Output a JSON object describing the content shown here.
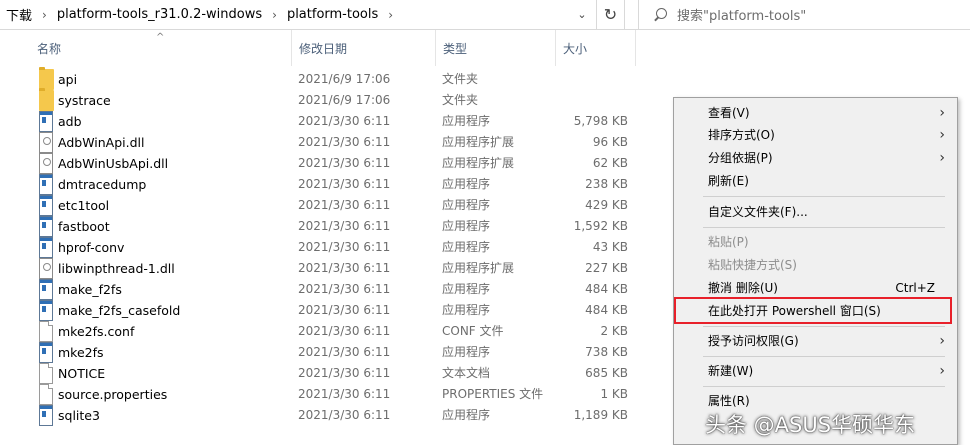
{
  "address_bar": {
    "crumbs": [
      "下载",
      "platform-tools_r31.0.2-windows",
      "platform-tools"
    ],
    "search_placeholder": "搜索\"platform-tools\""
  },
  "columns": {
    "name": "名称",
    "date": "修改日期",
    "type": "类型",
    "size": "大小"
  },
  "files": [
    {
      "name": "api",
      "date": "2021/6/9 17:06",
      "type": "文件夹",
      "size": "",
      "icon": "folder"
    },
    {
      "name": "systrace",
      "date": "2021/6/9 17:06",
      "type": "文件夹",
      "size": "",
      "icon": "folder"
    },
    {
      "name": "adb",
      "date": "2021/3/30 6:11",
      "type": "应用程序",
      "size": "5,798 KB",
      "icon": "exe"
    },
    {
      "name": "AdbWinApi.dll",
      "date": "2021/3/30 6:11",
      "type": "应用程序扩展",
      "size": "96 KB",
      "icon": "dll"
    },
    {
      "name": "AdbWinUsbApi.dll",
      "date": "2021/3/30 6:11",
      "type": "应用程序扩展",
      "size": "62 KB",
      "icon": "dll"
    },
    {
      "name": "dmtracedump",
      "date": "2021/3/30 6:11",
      "type": "应用程序",
      "size": "238 KB",
      "icon": "exe"
    },
    {
      "name": "etc1tool",
      "date": "2021/3/30 6:11",
      "type": "应用程序",
      "size": "429 KB",
      "icon": "exe"
    },
    {
      "name": "fastboot",
      "date": "2021/3/30 6:11",
      "type": "应用程序",
      "size": "1,592 KB",
      "icon": "exe"
    },
    {
      "name": "hprof-conv",
      "date": "2021/3/30 6:11",
      "type": "应用程序",
      "size": "43 KB",
      "icon": "exe"
    },
    {
      "name": "libwinpthread-1.dll",
      "date": "2021/3/30 6:11",
      "type": "应用程序扩展",
      "size": "227 KB",
      "icon": "dll"
    },
    {
      "name": "make_f2fs",
      "date": "2021/3/30 6:11",
      "type": "应用程序",
      "size": "484 KB",
      "icon": "exe"
    },
    {
      "name": "make_f2fs_casefold",
      "date": "2021/3/30 6:11",
      "type": "应用程序",
      "size": "484 KB",
      "icon": "exe"
    },
    {
      "name": "mke2fs.conf",
      "date": "2021/3/30 6:11",
      "type": "CONF 文件",
      "size": "2 KB",
      "icon": "file"
    },
    {
      "name": "mke2fs",
      "date": "2021/3/30 6:11",
      "type": "应用程序",
      "size": "738 KB",
      "icon": "exe"
    },
    {
      "name": "NOTICE",
      "date": "2021/3/30 6:11",
      "type": "文本文档",
      "size": "685 KB",
      "icon": "file"
    },
    {
      "name": "source.properties",
      "date": "2021/3/30 6:11",
      "type": "PROPERTIES 文件",
      "size": "1 KB",
      "icon": "file"
    },
    {
      "name": "sqlite3",
      "date": "2021/3/30 6:11",
      "type": "应用程序",
      "size": "1,189 KB",
      "icon": "exe"
    }
  ],
  "context_menu": {
    "view": "查看(V)",
    "sort_by": "排序方式(O)",
    "group_by": "分组依据(P)",
    "refresh": "刷新(E)",
    "customize_folder": "自定义文件夹(F)...",
    "paste": "粘贴(P)",
    "paste_shortcut": "粘贴快捷方式(S)",
    "undo_delete": "撤消 删除(U)",
    "undo_shortcut": "Ctrl+Z",
    "open_powershell": "在此处打开 Powershell 窗口(S)",
    "grant_access": "授予访问权限(G)",
    "new": "新建(W)",
    "properties": "属性(R)"
  },
  "watermark": "头条 @ASUS华硕华东",
  "colors": {
    "highlight_border": "#e8202a",
    "header_text": "#4c607a",
    "menu_bg": "#f0f0f0"
  }
}
